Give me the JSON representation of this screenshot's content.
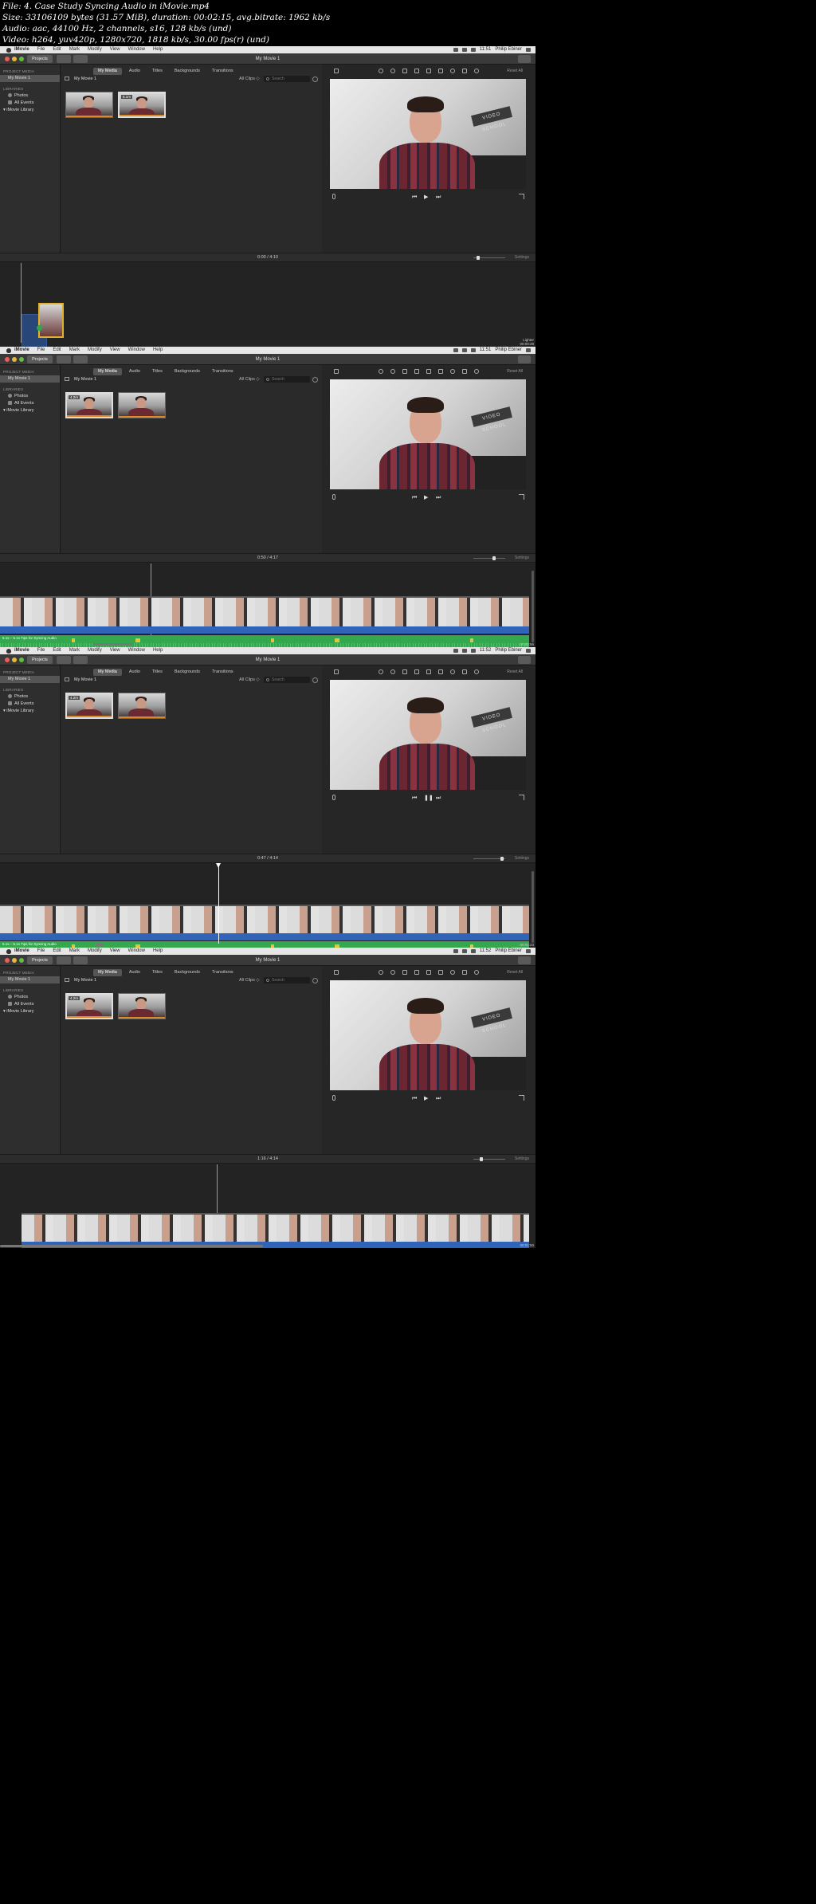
{
  "header_lines": [
    "File: 4. Case Study Syncing Audio in iMovie.mp4",
    "Size: 33106109 bytes (31.57 MiB), duration: 00:02:15, avg.bitrate: 1962 kb/s",
    "Audio: aac, 44100 Hz, 2 channels, s16, 128 kb/s (und)",
    "Video: h264, yuv420p, 1280x720, 1818 kb/s, 30.00 fps(r) (und)"
  ],
  "menubar": {
    "app": "iMovie",
    "items": [
      "File",
      "Edit",
      "Mark",
      "Modify",
      "View",
      "Window",
      "Help"
    ],
    "user": "Philip Ebiner"
  },
  "toolbar": {
    "projects_label": "Projects",
    "window_title": "My Movie 1"
  },
  "sidebar": {
    "project_media_heading": "PROJECT MEDIA",
    "project_item": "My Movie 1",
    "libraries_heading": "LIBRARIES",
    "library_items": [
      "Photos",
      "All Events",
      "iMovie Library"
    ]
  },
  "media": {
    "tabs": [
      "My Media",
      "Audio",
      "Titles",
      "Backgrounds",
      "Transitions"
    ],
    "breadcrumb": "My Movie 1",
    "filter": "All Clips",
    "search_placeholder": "Search"
  },
  "viewer": {
    "reset_label": "Reset All"
  },
  "timeline": {
    "settings_label": "Settings",
    "audio_clip_label": "5.1s – 5.1s Tips for Syncing Audio"
  },
  "frames": [
    {
      "clock": "11:51",
      "timecode": "0:00 / 4:10",
      "thumb_durations": [
        "",
        "6.1m"
      ],
      "watermark_line1": "Lighter",
      "watermark_line2": "00:00:28",
      "playing": false
    },
    {
      "clock": "11:51",
      "timecode": "0:50 / 4:17",
      "thumb_durations": [
        "4.2m",
        ""
      ],
      "watermark_line1": "",
      "watermark_line2": "00:00:56",
      "playing": false
    },
    {
      "clock": "11:52",
      "timecode": "0:47 / 4:14",
      "thumb_durations": [
        "4.2m",
        ""
      ],
      "watermark_line1": "",
      "watermark_line2": "00:01:23",
      "playing": true
    },
    {
      "clock": "11:52",
      "timecode": "1:16 / 4:14",
      "thumb_durations": [
        "4.2m",
        ""
      ],
      "watermark_line1": "",
      "watermark_line2": "00:01:50",
      "playing": false
    }
  ],
  "colors": {
    "audio_green": "#34a84f",
    "video_blue": "#2f64b8",
    "selection_yellow": "#e2b12c"
  }
}
